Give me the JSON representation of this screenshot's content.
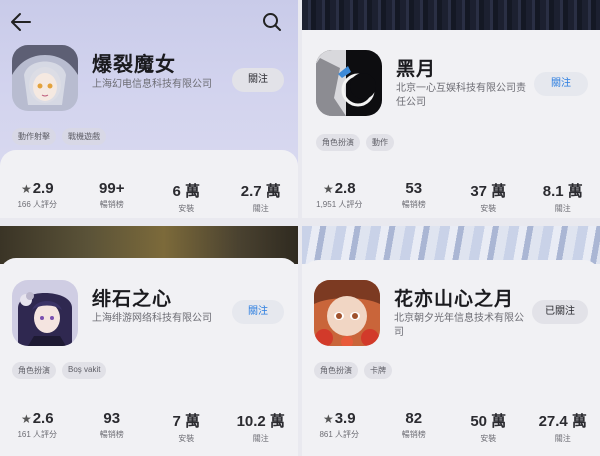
{
  "nav": {
    "back_icon": "arrow-left-icon",
    "search_icon": "search-icon"
  },
  "cards": [
    {
      "name": "爆裂魔女",
      "developer": "上海幻电信息科技有限公司",
      "follow_label": "關注",
      "tags": [
        "動作射擊",
        "戰機遊戲"
      ],
      "stats": [
        {
          "value": "2.9",
          "label": "166 人評分",
          "star": true
        },
        {
          "value": "99+",
          "label": "暢销榜"
        },
        {
          "value": "6 萬",
          "label": "安裝"
        },
        {
          "value": "2.7 萬",
          "label": "關注"
        }
      ]
    },
    {
      "name": "黑月",
      "developer": "北京一心互娱科技有限公司责任公司",
      "follow_label": "關注",
      "tags": [
        "角色扮演",
        "動作"
      ],
      "stats": [
        {
          "value": "2.8",
          "label": "1,951 人評分",
          "star": true
        },
        {
          "value": "53",
          "label": "暢销榜"
        },
        {
          "value": "37 萬",
          "label": "安裝"
        },
        {
          "value": "8.1 萬",
          "label": "關注"
        }
      ]
    },
    {
      "name": "绯石之心",
      "developer": "上海绯游网络科技有限公司",
      "follow_label": "關注",
      "tags": [
        "角色扮演",
        "Boş vakit"
      ],
      "stats": [
        {
          "value": "2.6",
          "label": "161 人評分",
          "star": true
        },
        {
          "value": "93",
          "label": "暢销榜"
        },
        {
          "value": "7 萬",
          "label": "安裝"
        },
        {
          "value": "10.2 萬",
          "label": "關注"
        }
      ]
    },
    {
      "name": "花亦山心之月",
      "developer": "北京朝夕光年信息技术有限公司",
      "follow_label": "已關注",
      "tags": [
        "角色扮演",
        "卡牌"
      ],
      "stats": [
        {
          "value": "3.9",
          "label": "861 人評分",
          "star": true
        },
        {
          "value": "82",
          "label": "暢销榜"
        },
        {
          "value": "50 萬",
          "label": "安裝"
        },
        {
          "value": "27.4 萬",
          "label": "關注"
        }
      ]
    }
  ],
  "colors": {
    "accent": "#2a7de0",
    "panel_bg": "#f1f1f4",
    "header_lavender": "#cfd0ec"
  }
}
